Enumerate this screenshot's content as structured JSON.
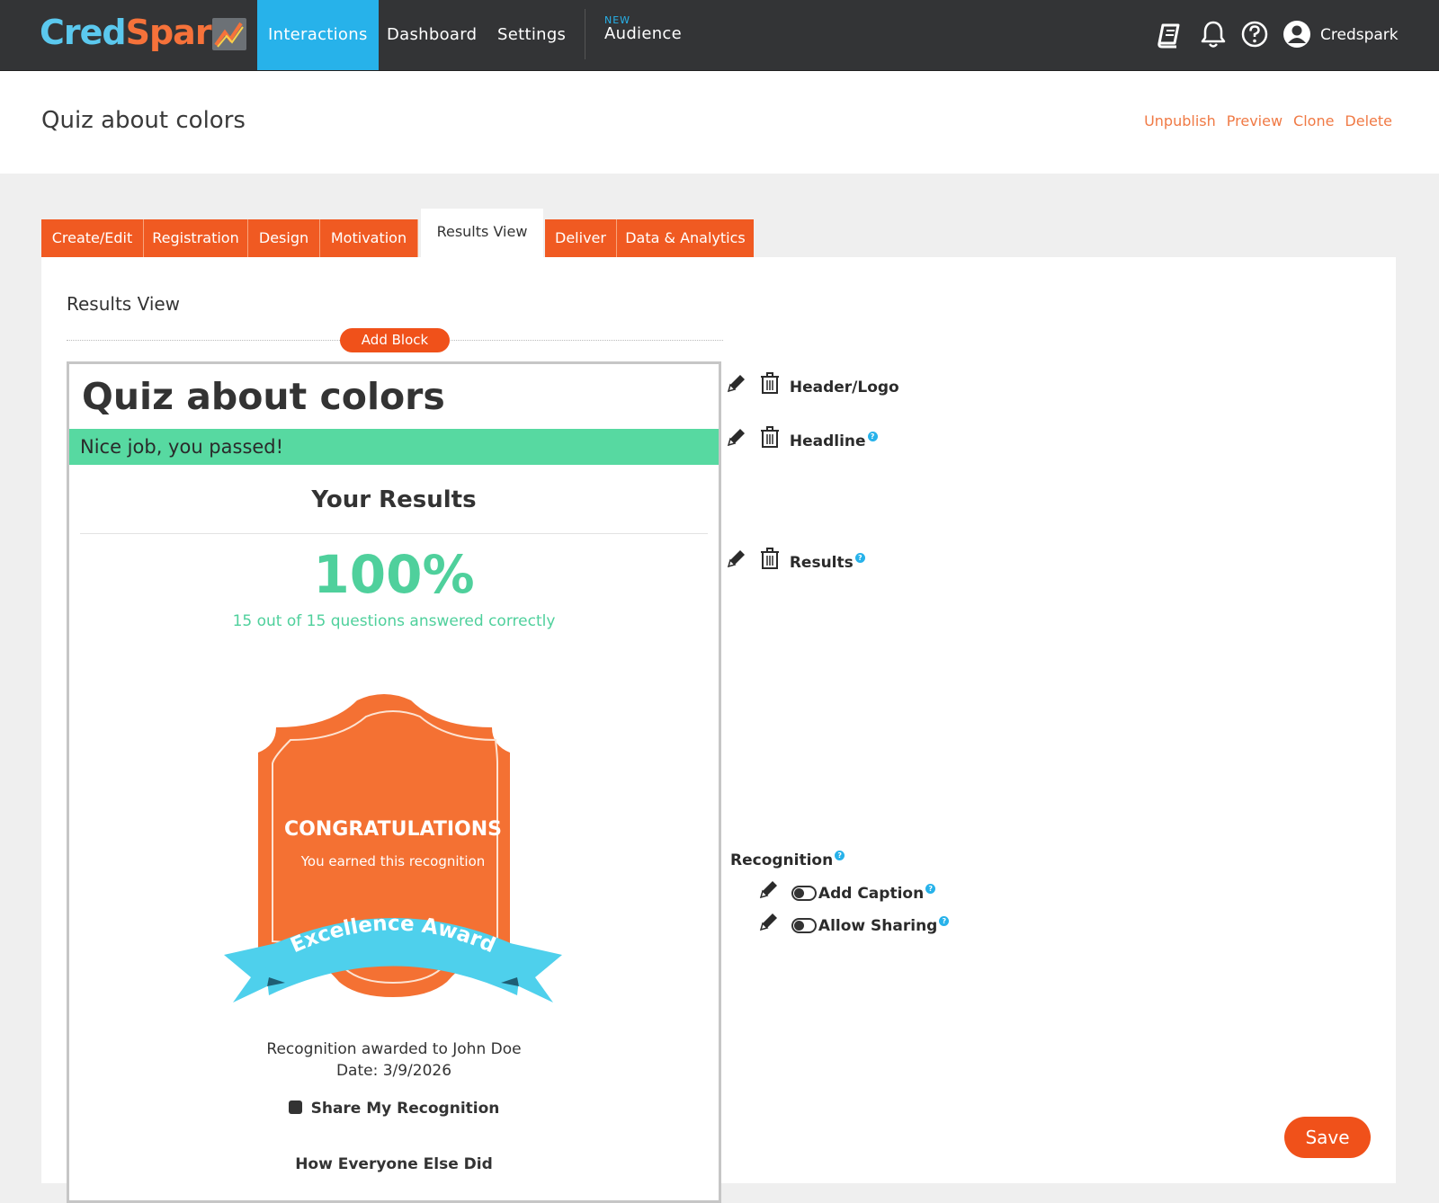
{
  "brand": {
    "part1": "Cred",
    "part2": "Spark"
  },
  "nav": {
    "items": [
      "Interactions",
      "Dashboard",
      "Settings"
    ],
    "new_badge": "NEW",
    "audience": "Audience",
    "user": "Credspark"
  },
  "page": {
    "title": "Quiz about colors",
    "actions": [
      "Unpublish",
      "Preview",
      "Clone",
      "Delete"
    ]
  },
  "tabs": [
    "Create/Edit",
    "Registration",
    "Design",
    "Motivation",
    "Results View",
    "Deliver",
    "Data & Analytics"
  ],
  "active_tab": "Results View",
  "editor": {
    "section_label": "Results View",
    "add_block": "Add Block",
    "save": "Save"
  },
  "preview": {
    "title": "Quiz about colors",
    "headline": "Nice job, you passed!",
    "your_results": "Your Results",
    "score": "100%",
    "score_detail": "15 out of 15 questions answered correctly",
    "badge_title": "CONGRATULATIONS",
    "badge_subtitle": "You earned this recognition",
    "badge_ribbon": "Excellence Award",
    "awarded": "Recognition awarded to John Doe",
    "date": "Date: 3/9/2026",
    "share": "Share My Recognition",
    "cut_text": "How Everyone Else Did"
  },
  "blocks": {
    "header": "Header/Logo",
    "headline": "Headline",
    "results": "Results",
    "recognition": "Recognition",
    "add_caption": "Add Caption",
    "allow_sharing": "Allow Sharing"
  },
  "colors": {
    "nav_bg": "#333436",
    "accent_blue": "#27b2ea",
    "accent_orange": "#f05a22",
    "success_green": "#57d9a1"
  }
}
